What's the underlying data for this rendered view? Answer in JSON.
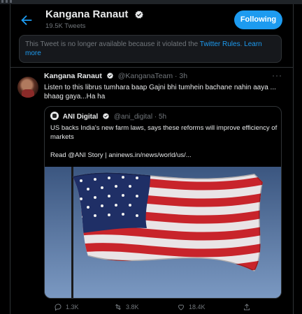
{
  "header": {
    "title": "Kangana Ranaut",
    "tweet_count": "19.5K Tweets",
    "follow_label": "Following"
  },
  "notice": {
    "text": "This Tweet is no longer available because it violated the ",
    "link": "Twitter Rules",
    "link2": "Learn more"
  },
  "tweet": {
    "name": "Kangana Ranaut",
    "handle": "@KanganaTeam",
    "time": "· 3h",
    "text": "Listen to this librus tumhara baap Gajni bhi tumhein bachane nahin aaya ... bhaag gaya...Ha ha",
    "replies": "1.3K",
    "retweets": "3.8K",
    "likes": "18.4K"
  },
  "quote": {
    "name": "ANI Digital",
    "handle": "@ani_digital",
    "time": "· 5h",
    "text": "US backs India's new farm laws, says these reforms will improve efficiency of markets",
    "link_line": "Read @ANI Story | aninews.in/news/world/us/..."
  },
  "colors": {
    "accent": "#1d9bf0",
    "flag_red": "#c8242b",
    "flag_blue": "#1f2f66"
  }
}
